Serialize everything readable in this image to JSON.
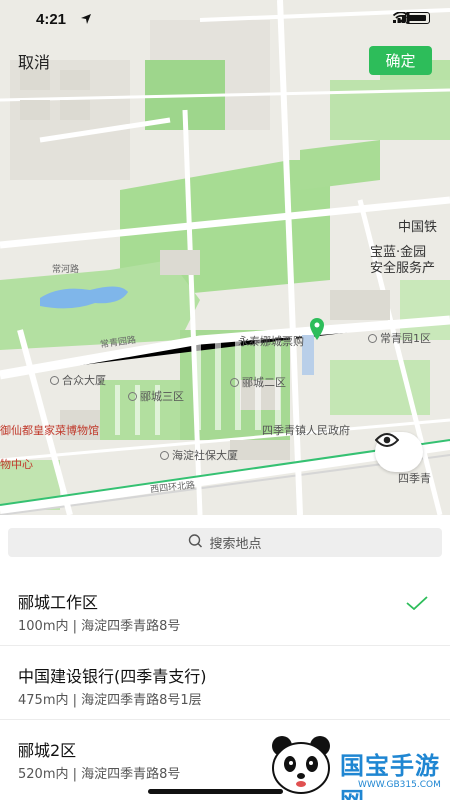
{
  "status_bar": {
    "time": "4:21"
  },
  "header": {
    "cancel_label": "取消",
    "confirm_label": "确定"
  },
  "map": {
    "labels": {
      "station": "中国铁",
      "baolan": "宝蓝·金园",
      "baolan2": "安全服务产",
      "changqing_road": "常青园路",
      "yongji": "永泰娜城票购",
      "changqing1": "常青园1区",
      "hezhong": "合众大厦",
      "yicheng2": "郦城二区",
      "yicheng3": "郦城三区",
      "museum": "御仙都皇家菜博物馆",
      "gov": "四季青镇人民政府",
      "haidian": "海淀社保大厦",
      "center": "物中心",
      "xisihuan": "西四环北路",
      "changhe": "常河路",
      "siji": "四季青",
      "changqing_rd2": "常河路"
    }
  },
  "search": {
    "placeholder": "搜索地点"
  },
  "results": [
    {
      "name": "郦城工作区",
      "address": "100m内 | 海淀四季青路8号",
      "selected": true
    },
    {
      "name": "中国建设银行(四季青支行)",
      "address": "475m内 | 海淀四季青路8号1层",
      "selected": false
    },
    {
      "name": "郦城2区",
      "address": "520m内 | 海淀四季青路8号",
      "selected": false
    }
  ],
  "watermark": {
    "brand": "国宝手游网",
    "url": "WWW.GB315.COM"
  },
  "colors": {
    "accent": "#2dbd5a",
    "park": "#8fcf7e",
    "road": "#ffffff"
  }
}
